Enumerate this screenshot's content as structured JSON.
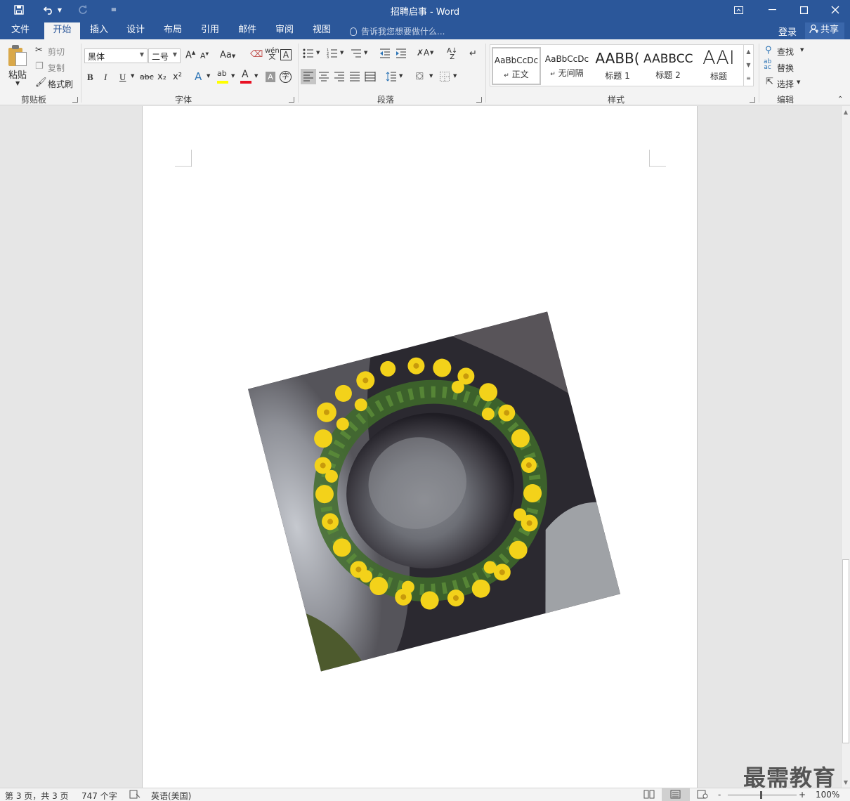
{
  "window": {
    "title": "招聘启事 - Word",
    "quick_access": {
      "save_icon": "save-icon",
      "undo_icon": "undo-icon",
      "redo_icon": "redo-icon",
      "customize_icon": "customize-icon"
    },
    "controls": {
      "restore_ribbon": "ribbon-display-icon",
      "minimize": "minimize-icon",
      "maximize": "maximize-icon",
      "close": "close-icon"
    }
  },
  "tabs": [
    {
      "label": "文件",
      "active": false
    },
    {
      "label": "开始",
      "active": true
    },
    {
      "label": "插入",
      "active": false
    },
    {
      "label": "设计",
      "active": false
    },
    {
      "label": "布局",
      "active": false
    },
    {
      "label": "引用",
      "active": false
    },
    {
      "label": "邮件",
      "active": false
    },
    {
      "label": "审阅",
      "active": false
    },
    {
      "label": "视图",
      "active": false
    }
  ],
  "tell_me": "告诉我您想要做什么...",
  "account": {
    "login": "登录",
    "share": "共享"
  },
  "ribbon": {
    "clipboard": {
      "label": "剪贴板",
      "paste": "粘贴",
      "cut": "剪切",
      "copy": "复制",
      "format_painter": "格式刷"
    },
    "font": {
      "label": "字体",
      "font_name": "黑体",
      "font_size": "二号",
      "bold": "B",
      "italic": "I",
      "underline": "U",
      "strike": "abc",
      "sub": "x₂",
      "sup": "x²",
      "change_case": "Aa",
      "font_color_hex": "#e81123",
      "highlight_hex": "#ffff00"
    },
    "paragraph": {
      "label": "段落"
    },
    "styles": {
      "label": "样式",
      "items": [
        {
          "preview": "AaBbCcDc",
          "name": "正文",
          "selected": true
        },
        {
          "preview": "AaBbCcDc",
          "name": "无间隔",
          "selected": false
        },
        {
          "preview": "AABB(",
          "name": "标题 1",
          "selected": false
        },
        {
          "preview": "AABBCC",
          "name": "标题 2",
          "selected": false
        },
        {
          "preview": "AAI",
          "name": "标题",
          "selected": false
        }
      ]
    },
    "editing": {
      "label": "编辑",
      "find": "查找",
      "replace": "替换",
      "select": "选择"
    }
  },
  "status": {
    "page": "第 3 页，共 3 页",
    "words": "747 个字",
    "language": "英语(美国)",
    "zoom": "100%",
    "zoom_minus": "-",
    "zoom_plus": "+"
  },
  "watermark": "最需教育",
  "colors": {
    "brand": "#2b579a",
    "ribbon_bg": "#f3f3f3",
    "page_bg": "#ffffff",
    "canvas_bg": "#e6e6e6"
  }
}
